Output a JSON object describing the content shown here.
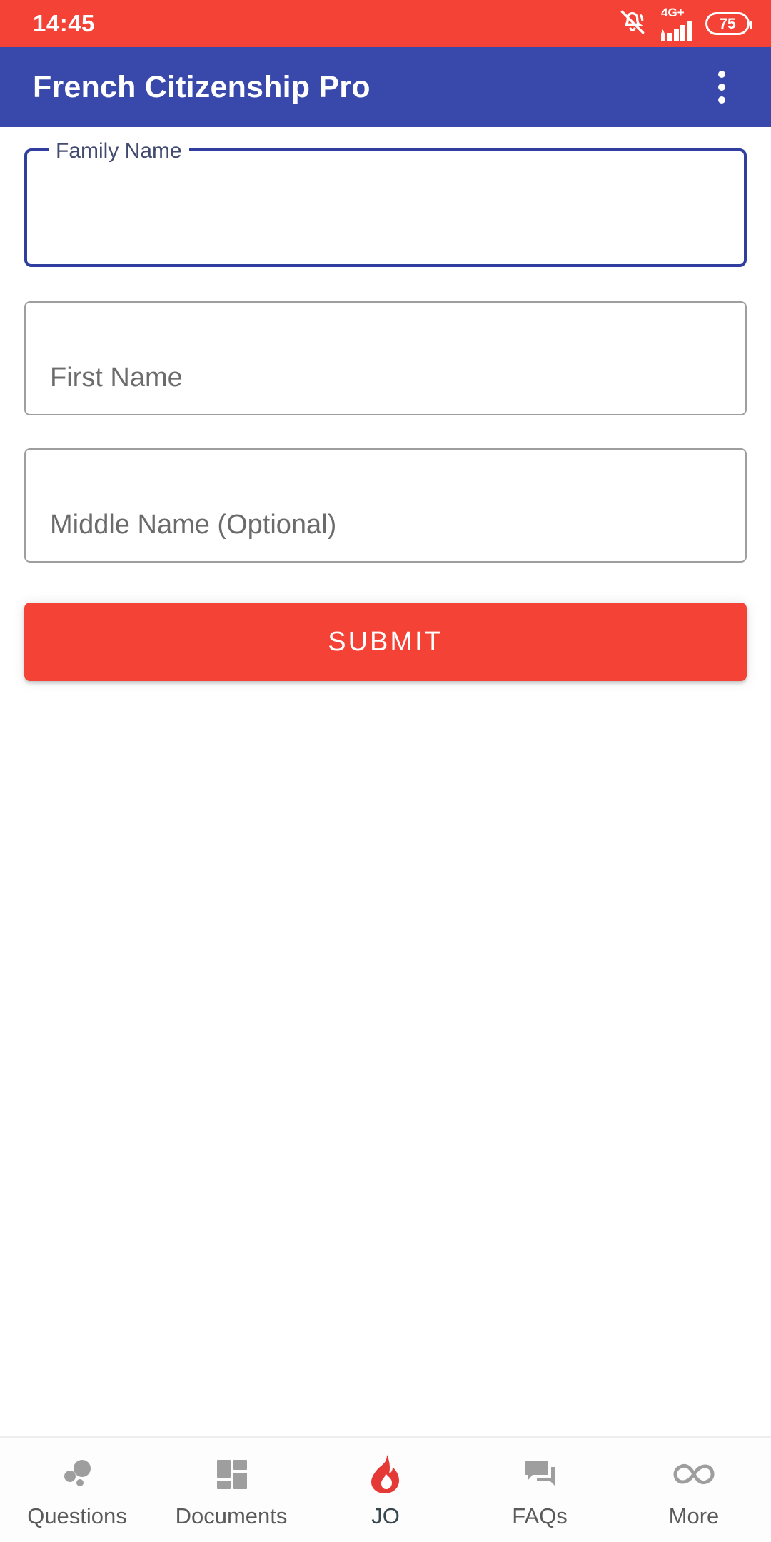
{
  "status_bar": {
    "time": "14:45",
    "network_label": "4G+",
    "battery_level": "75",
    "icons": [
      "bell-muted-icon",
      "signal-bars-icon",
      "battery-icon"
    ],
    "background_color": "#f44336"
  },
  "app_bar": {
    "title": "French Citizenship Pro",
    "overflow_menu_name": "more-options-icon",
    "background_color": "#3949ab"
  },
  "form": {
    "fields": [
      {
        "name": "family-name",
        "label": "Family Name",
        "value": "",
        "placeholder": "",
        "focused": true,
        "border_color": "#303f9f"
      },
      {
        "name": "first-name",
        "label": "First Name",
        "value": "",
        "placeholder": "First Name",
        "focused": false,
        "border_color": "#9e9e9e"
      },
      {
        "name": "middle-name",
        "label": "Middle Name (Optional)",
        "value": "",
        "placeholder": "Middle Name (Optional)",
        "focused": false,
        "border_color": "#9e9e9e"
      }
    ],
    "submit_label": "SUBMIT",
    "submit_color": "#f44336"
  },
  "bottom_nav": {
    "active_index": 2,
    "items": [
      {
        "label": "Questions",
        "icon": "bubbles-icon",
        "active": false
      },
      {
        "label": "Documents",
        "icon": "grid-tiles-icon",
        "active": false
      },
      {
        "label": "JO",
        "icon": "flame-icon",
        "active": true
      },
      {
        "label": "FAQs",
        "icon": "chat-bubbles-icon",
        "active": false
      },
      {
        "label": "More",
        "icon": "infinity-icon",
        "active": false
      }
    ],
    "inactive_color": "#9e9e9e",
    "active_color": "#e53935"
  }
}
